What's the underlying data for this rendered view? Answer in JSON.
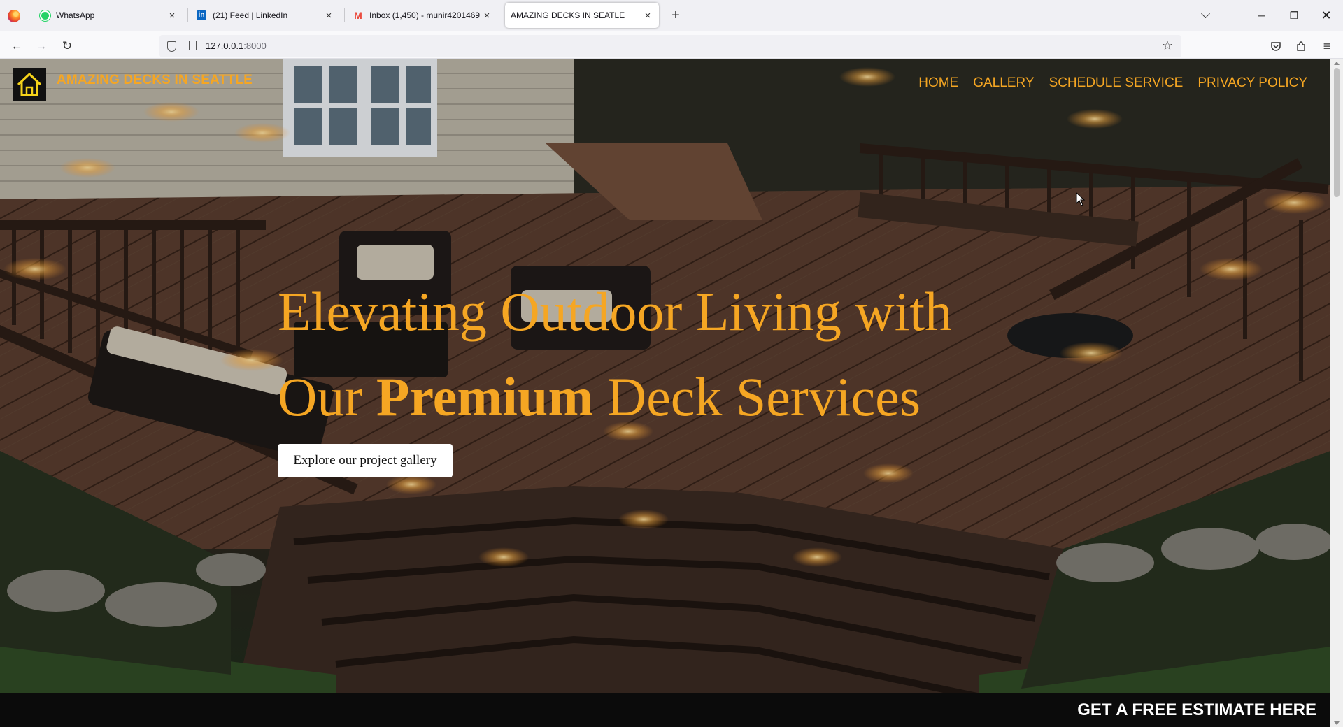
{
  "browser": {
    "tabs": [
      {
        "title": "WhatsApp",
        "icon": "whatsapp-icon",
        "active": false
      },
      {
        "title": "(21) Feed | LinkedIn",
        "icon": "linkedin-icon",
        "active": false
      },
      {
        "title": "Inbox (1,450) - munir4201469@",
        "icon": "gmail-icon",
        "active": false
      },
      {
        "title": "AMAZING DECKS IN SEATLE",
        "icon": "",
        "active": true
      }
    ],
    "url_host": "127.0.0.1",
    "url_port": ":8000"
  },
  "site": {
    "brand": "AMAZING DECKS IN SEATTLE",
    "nav": [
      "HOME",
      "GALLERY",
      "SCHEDULE SERVICE",
      "PRIVACY POLICY"
    ],
    "headline_line1": "Elevating Outdoor Living with",
    "headline_line2_pre": "Our ",
    "headline_line2_bold": "Premium",
    "headline_line2_post": " Deck Services",
    "cta_label": "Explore our project gallery",
    "estimate_label": "GET A FREE ESTIMATE HERE"
  },
  "colors": {
    "accent": "#f5a623",
    "footer_bar": "#0b0b0b"
  }
}
